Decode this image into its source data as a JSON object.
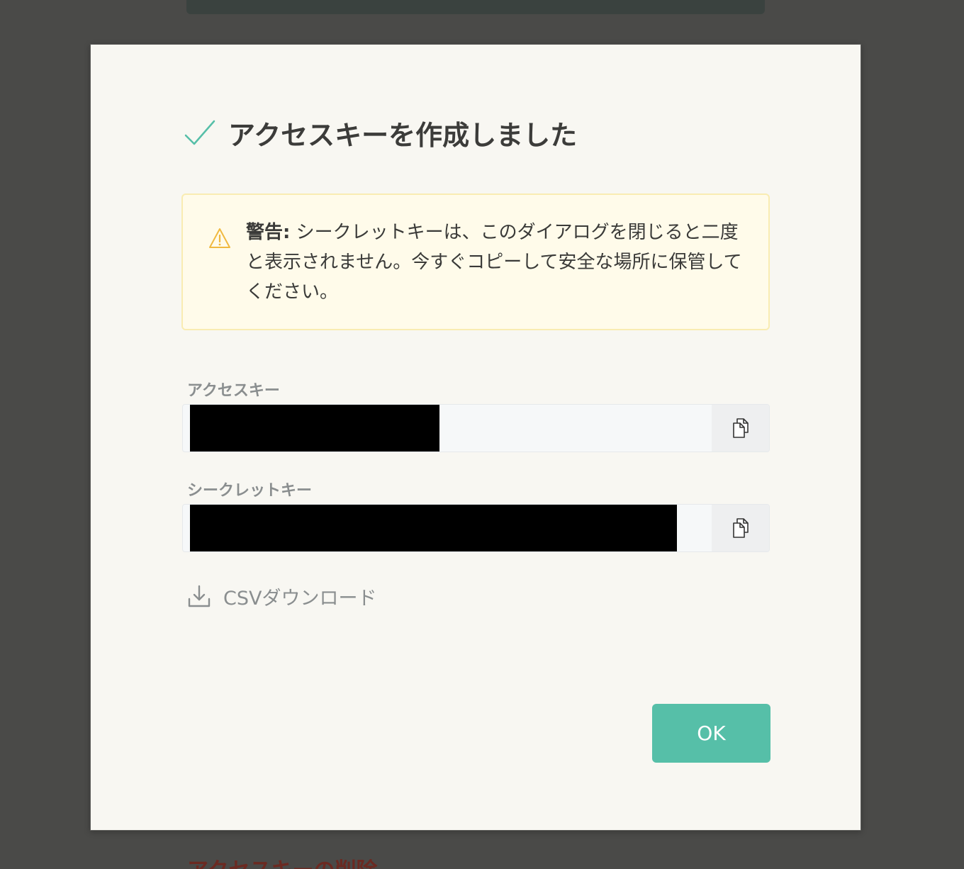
{
  "background": {
    "partial_heading": "アクセスキーの削除"
  },
  "dialog": {
    "title": "アクセスキーを作成しました",
    "title_icon": "checkmark-icon",
    "warning": {
      "icon": "warning-triangle-icon",
      "label": "警告:",
      "message": "シークレットキーは、このダイアログを閉じると二度と表示されません。今すぐコピーして安全な場所に保管してください。"
    },
    "fields": [
      {
        "label": "アクセスキー",
        "value": "",
        "redacted": true,
        "copy_icon": "copy-icon"
      },
      {
        "label": "シークレットキー",
        "value": "",
        "redacted": true,
        "copy_icon": "copy-icon"
      }
    ],
    "csv_download": {
      "icon": "download-icon",
      "label": "CSVダウンロード"
    },
    "ok_button": {
      "label": "OK"
    }
  },
  "colors": {
    "overlay": "#4a4a48",
    "dialog_background": "#f8f7f2",
    "accent": "#56bfa8",
    "warning_background": "#fffbea",
    "warning_border": "#f9ecb2",
    "warning_icon": "#f0b940",
    "muted_text": "#8a8e8f"
  }
}
